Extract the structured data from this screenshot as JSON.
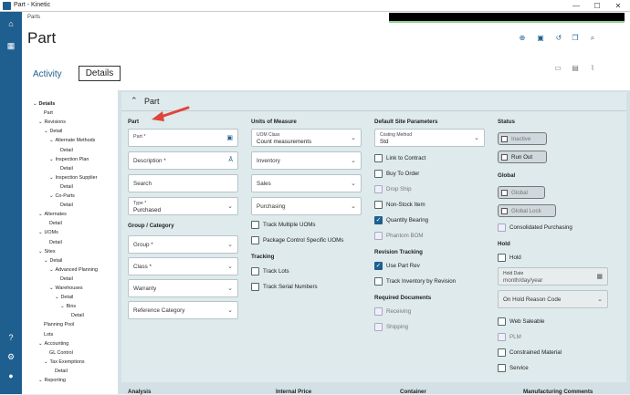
{
  "window": {
    "title": "Part - Kinetic",
    "minimize": "—",
    "maximize": "☐",
    "close": "✕"
  },
  "rail": {
    "home": "⌂",
    "grid": "▦",
    "help": "?",
    "settings": "⚙",
    "user": "●"
  },
  "breadcrumb": "Parts",
  "page_title": "Part",
  "tabs": [
    {
      "label": "Activity"
    },
    {
      "label": "Details"
    }
  ],
  "nav": [
    {
      "label": "Details",
      "level": 0,
      "expand": "⌄",
      "bold": true
    },
    {
      "label": "Part",
      "level": 1
    },
    {
      "label": "Revisions",
      "level": 1,
      "expand": "⌄"
    },
    {
      "label": "Detail",
      "level": 2,
      "expand": "⌄"
    },
    {
      "label": "Alternate Methods",
      "level": 3,
      "expand": "⌄"
    },
    {
      "label": "Detail",
      "level": 4
    },
    {
      "label": "Inspection Plan",
      "level": 3,
      "expand": "⌄"
    },
    {
      "label": "Detail",
      "level": 4
    },
    {
      "label": "Inspection Supplier",
      "level": 3,
      "expand": "⌄"
    },
    {
      "label": "Detail",
      "level": 4
    },
    {
      "label": "Co-Parts",
      "level": 3,
      "expand": "⌄"
    },
    {
      "label": "Detail",
      "level": 4
    },
    {
      "label": "Alternates",
      "level": 1,
      "expand": "⌄"
    },
    {
      "label": "Detail",
      "level": 2
    },
    {
      "label": "UOMs",
      "level": 1,
      "expand": "⌄"
    },
    {
      "label": "Detail",
      "level": 2
    },
    {
      "label": "Sites",
      "level": 1,
      "expand": "⌄"
    },
    {
      "label": "Detail",
      "level": 2,
      "expand": "⌄"
    },
    {
      "label": "Advanced Planning",
      "level": 3,
      "expand": "⌄"
    },
    {
      "label": "Detail",
      "level": 4
    },
    {
      "label": "Warehouses",
      "level": 3,
      "expand": "⌄"
    },
    {
      "label": "Detail",
      "level": 4,
      "expand": "⌄"
    },
    {
      "label": "Bins",
      "level": 5,
      "expand": "⌄"
    },
    {
      "label": "Detail",
      "level": 6
    },
    {
      "label": "Planning Pool",
      "level": 1
    },
    {
      "label": "Lots",
      "level": 1
    },
    {
      "label": "Accounting",
      "level": 1,
      "expand": "⌄"
    },
    {
      "label": "GL Control",
      "level": 2
    },
    {
      "label": "Tax Exemptions",
      "level": 2,
      "expand": "⌄"
    },
    {
      "label": "Detail",
      "level": 3
    },
    {
      "label": "Reporting",
      "level": 1,
      "expand": "⌄"
    }
  ],
  "panel": {
    "title": "Part",
    "part_section": "Part",
    "part_field": "Part *",
    "description_field": "Description *",
    "search_field": "Search",
    "type_label": "Type *",
    "type_value": "Purchased",
    "group_section": "Group / Category",
    "group_field": "Group *",
    "class_field": "Class *",
    "warranty_field": "Warranty",
    "refcat_field": "Reference Category",
    "uom_section": "Units of Measure",
    "uom_class_label": "UOM Class",
    "uom_class_value": "Count measurements",
    "inventory_field": "Inventory",
    "sales_field": "Sales",
    "purchasing_field": "Purchasing",
    "track_multiple_uoms": "Track Multiple UOMs",
    "package_control": "Package Control Specific UOMs",
    "tracking_section": "Tracking",
    "track_lots": "Track Lots",
    "track_serial": "Track Serial Numbers",
    "site_section": "Default Site Parameters",
    "costing_label": "Costing Method",
    "costing_value": "Std",
    "link_to_contract": "Link to Contract",
    "buy_to_order": "Buy To Order",
    "drop_ship": "Drop Ship",
    "non_stock": "Non-Stock Item",
    "quantity_bearing": "Quantity Bearing",
    "phantom_bom": "Phantom BOM",
    "revision_section": "Revision Tracking",
    "use_part_rev": "Use Part Rev",
    "track_inv_rev": "Track Inventory by Revision",
    "required_section": "Required Documents",
    "receiving": "Receiving",
    "shipping": "Shipping",
    "status_section": "Status",
    "inactive": "Inactive",
    "run_out": "Run Out",
    "global_section": "Global",
    "global": "Global",
    "global_lock": "Global Lock",
    "consolidated": "Consolidated Purchasing",
    "hold_section": "Hold",
    "hold": "Hold",
    "hold_date_label": "Hold Date",
    "hold_date_placeholder": "month/day/year",
    "hold_reason": "On Hold Reason Code",
    "web_saleable": "Web Saleable",
    "plm": "PLM",
    "constrained": "Constrained Material",
    "service": "Service"
  },
  "bottom": {
    "analysis": "Analysis",
    "internal_price": "Internal Price",
    "container": "Container",
    "mfg_comments": "Manufacturing Comments"
  },
  "checkbox_states": {
    "quantity_bearing": true,
    "use_part_rev": true
  },
  "colors": {
    "accent": "#1f5f8f",
    "arrow": "#e0453a"
  }
}
